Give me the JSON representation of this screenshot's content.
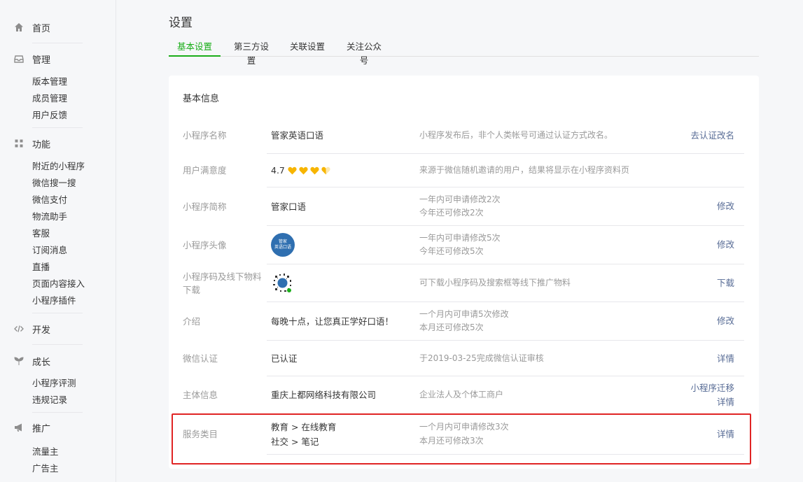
{
  "sidebar": {
    "home": "首页",
    "manage": {
      "title": "管理",
      "items": [
        "版本管理",
        "成员管理",
        "用户反馈"
      ]
    },
    "features": {
      "title": "功能",
      "items": [
        "附近的小程序",
        "微信搜一搜",
        "微信支付",
        "物流助手",
        "客服",
        "订阅消息",
        "直播",
        "页面内容接入",
        "小程序插件"
      ]
    },
    "dev": "开发",
    "growth": {
      "title": "成长",
      "items": [
        "小程序评测",
        "违规记录"
      ]
    },
    "promo": {
      "title": "推广",
      "items": [
        "流量主",
        "广告主"
      ]
    }
  },
  "page": {
    "title": "设置"
  },
  "tabs": [
    "基本设置",
    "第三方设置",
    "关联设置",
    "关注公众号"
  ],
  "card": {
    "title": "基本信息",
    "rows": [
      {
        "label": "小程序名称",
        "value": "管家英语口语",
        "desc": "小程序发布后，非个人类帐号可通过认证方式改名。",
        "action": "去认证改名"
      },
      {
        "label": "用户满意度",
        "value": "4.7",
        "rating": 4.7,
        "desc": "来源于微信随机邀请的用户，结果将显示在小程序资料页"
      },
      {
        "label": "小程序简称",
        "value": "管家口语",
        "desc1": "一年内可申请修改2次",
        "desc2": "今年还可修改2次",
        "action": "修改"
      },
      {
        "label": "小程序头像",
        "avatar_text1": "管家",
        "avatar_text2": "英语口语",
        "desc1": "一年内可申请修改5次",
        "desc2": "今年还可修改5次",
        "action": "修改"
      },
      {
        "label1": "小程序码及线下物料",
        "label2": "下载",
        "desc": "可下载小程序码及搜索框等线下推广物料",
        "action": "下载"
      },
      {
        "label": "介绍",
        "value": "每晚十点，让您真正学好口语！",
        "desc1": "一个月内可申请5次修改",
        "desc2": "本月还可修改5次",
        "action": "修改"
      },
      {
        "label": "微信认证",
        "value": "已认证",
        "desc": "于2019-03-25完成微信认证审核",
        "action": "详情"
      },
      {
        "label": "主体信息",
        "value": "重庆上都网络科技有限公司",
        "desc": "企业法人及个体工商户",
        "action1": "小程序迁移",
        "action2": "详情"
      },
      {
        "label": "服务类目",
        "value1": "教育 > 在线教育",
        "value2": "社交 > 笔记",
        "desc1": "一个月内可申请修改3次",
        "desc2": "本月还可修改3次",
        "action": "详情"
      }
    ]
  },
  "colors": {
    "accent": "#1aad19",
    "link": "#576b95",
    "highlight": "#e02424",
    "heart": "#f7b500"
  }
}
